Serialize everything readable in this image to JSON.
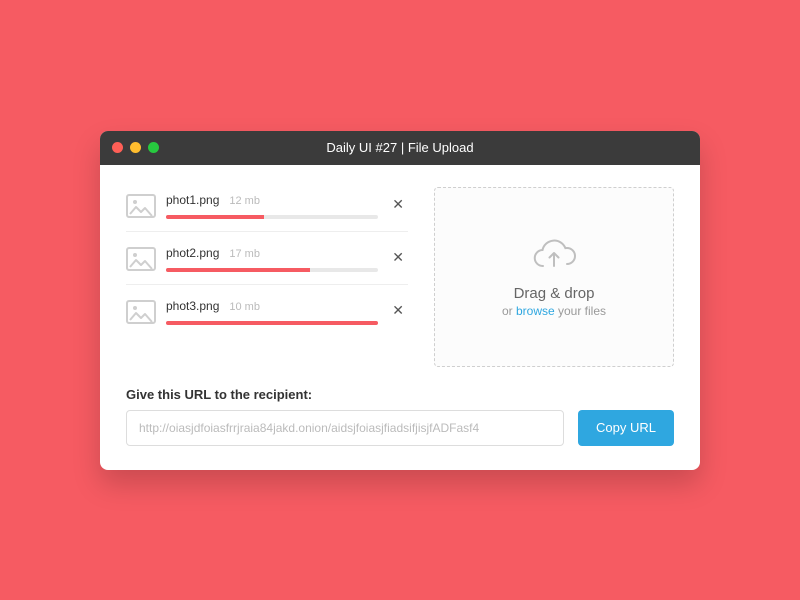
{
  "window": {
    "title": "Daily UI #27 | File Upload"
  },
  "files": [
    {
      "name": "phot1.png",
      "size": "12 mb",
      "progress_pct": 46
    },
    {
      "name": "phot2.png",
      "size": "17 mb",
      "progress_pct": 68
    },
    {
      "name": "phot3.png",
      "size": "10 mb",
      "progress_pct": 100
    }
  ],
  "dropzone": {
    "title": "Drag & drop",
    "prefix": "or ",
    "link": "browse",
    "suffix": " your files"
  },
  "url": {
    "label": "Give this URL to the recipient:",
    "value": "http://oiasjdfoiasfrrjraia84jakd.onion/aidsjfoiasjfiadsifjisjfADFasf4",
    "copy_label": "Copy URL"
  },
  "colors": {
    "accent": "#f65b62",
    "link": "#2fa7e0"
  }
}
